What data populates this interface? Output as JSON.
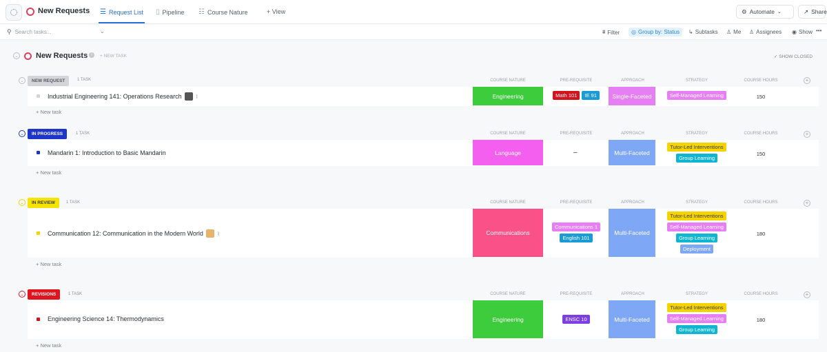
{
  "header": {
    "title": "New Requests",
    "tabs": [
      {
        "label": "Request List",
        "icon": "list-icon",
        "active": true
      },
      {
        "label": "Pipeline",
        "icon": "board-icon"
      },
      {
        "label": "Course Nature",
        "icon": "table-icon"
      }
    ],
    "add_view": "+ View",
    "automate": "Automate",
    "share": "Share"
  },
  "toolbar": {
    "search_placeholder": "Search tasks...",
    "filter": "Filter",
    "group_by": "Group by: Status",
    "subtasks": "Subtasks",
    "me": "Me",
    "assignees": "Assignees",
    "show": "Show",
    "more": "•••"
  },
  "list": {
    "title": "New Requests",
    "new_task": "+ NEW TASK",
    "show_closed": "SHOW CLOSED"
  },
  "columns": [
    "COURSE NATURE",
    "PRE-REQUISITE",
    "APPROACH",
    "STRATEGY",
    "COURSE HOURS"
  ],
  "colors": {
    "engineering": "#3ccc3c",
    "language": "#f45ff0",
    "communications": "#fa5288",
    "single_faceted": "#e67ef4",
    "multi_faceted": "#7ea7f6"
  },
  "groups": [
    {
      "status": "NEW REQUEST",
      "status_color": "#d3d5d9",
      "status_text_color": "#555a63",
      "count": "1 TASK",
      "new_task": "+ New task",
      "task": {
        "name": "Industrial Engineering 141: Operations Research",
        "bullet_color": "#d3d5d9",
        "course_nature": "Engineering",
        "prerequisites": [
          {
            "label": "Math 101",
            "color": "#d2141e"
          },
          {
            "label": "IE 91",
            "color": "#1b9bd6"
          }
        ],
        "approach": "Single-Faceted",
        "strategies": [
          {
            "label": "Self-Managed Learning",
            "color": "#e67ef4"
          }
        ],
        "hours": "150"
      }
    },
    {
      "status": "IN PROGRESS",
      "status_color": "#1d35c9",
      "status_text_color": "#ffffff",
      "count": "1 TASK",
      "new_task": "+ New task",
      "task": {
        "name": "Mandarin 1: Introduction to Basic Mandarin",
        "bullet_color": "#1d35c9",
        "course_nature": "Language",
        "prerequisites_empty": "–",
        "approach": "Multi-Faceted",
        "strategies": [
          {
            "label": "Tutor-Led Interventions",
            "color": "#f5d300",
            "text": "#3a3a3a"
          },
          {
            "label": "Group Learning",
            "color": "#10b6d1"
          }
        ],
        "hours": "150"
      }
    },
    {
      "status": "IN REVIEW",
      "status_color": "#f5e400",
      "status_text_color": "#3a3a3a",
      "count": "1 TASK",
      "new_task": "+ New task",
      "task": {
        "name": "Communication 12: Communication in the Modern World",
        "bullet_color": "#f5d300",
        "course_nature": "Communications",
        "prerequisites": [
          {
            "label": "Communications 1",
            "color": "#e67ef4"
          },
          {
            "label": "English 101",
            "color": "#1b9bd6"
          }
        ],
        "approach": "Multi-Faceted",
        "strategies": [
          {
            "label": "Tutor-Led Interventions",
            "color": "#f5d300",
            "text": "#3a3a3a"
          },
          {
            "label": "Self-Managed Learning",
            "color": "#e67ef4"
          },
          {
            "label": "Group Learning",
            "color": "#10b6d1"
          },
          {
            "label": "Deployment",
            "color": "#7ea7f6"
          }
        ],
        "hours": "180"
      }
    },
    {
      "status": "REVISIONS",
      "status_color": "#e0141e",
      "status_text_color": "#ffffff",
      "count": "1 TASK",
      "new_task": "+ New task",
      "task": {
        "name": "Engineering Science 14: Thermodynamics",
        "bullet_color": "#d2141e",
        "course_nature": "Engineering",
        "prerequisites": [
          {
            "label": "ENSC 10",
            "color": "#7b3fe4"
          }
        ],
        "approach": "Multi-Faceted",
        "strategies": [
          {
            "label": "Tutor-Led Interventions",
            "color": "#f5d300",
            "text": "#3a3a3a"
          },
          {
            "label": "Self-Managed Learning",
            "color": "#e67ef4"
          },
          {
            "label": "Group Learning",
            "color": "#10b6d1"
          }
        ],
        "hours": "180"
      }
    }
  ]
}
